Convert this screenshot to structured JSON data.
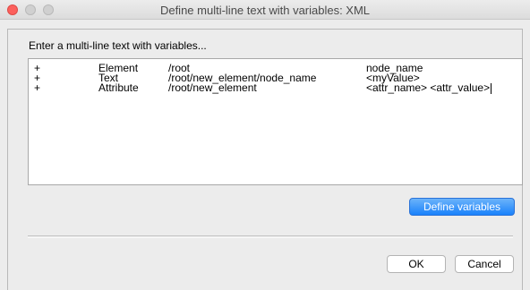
{
  "window": {
    "title": "Define multi-line text with variables: XML"
  },
  "prompt": "Enter a multi-line text with variables...",
  "rows": [
    {
      "plus": "+",
      "type": "Element",
      "path": "/root",
      "value": "node_name"
    },
    {
      "plus": "+",
      "type": "Text",
      "path": "/root/new_element/node_name",
      "value": "<myValue>"
    },
    {
      "plus": "+",
      "type": "Attribute",
      "path": "/root/new_element",
      "value": "<attr_name>  <attr_value>"
    }
  ],
  "buttons": {
    "define_variables": "Define variables",
    "ok": "OK",
    "cancel": "Cancel"
  },
  "colors": {
    "close": "#fc605c",
    "accent": "#1a82fb"
  }
}
